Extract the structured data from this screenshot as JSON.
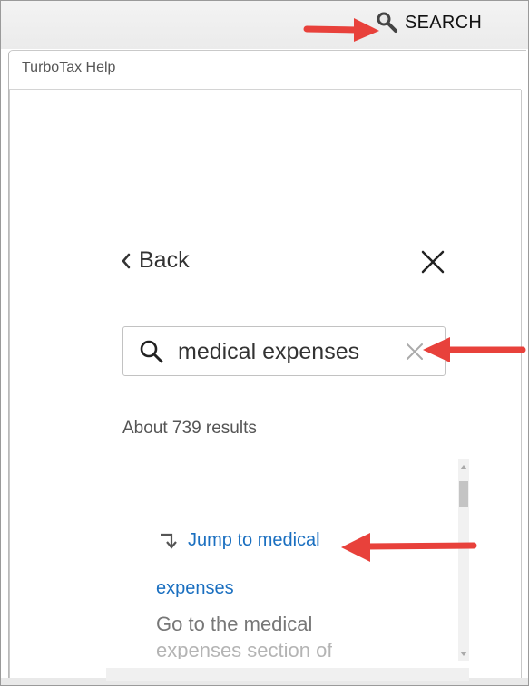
{
  "top_bar": {
    "search_label": "SEARCH",
    "search_icon": "magnifier-icon"
  },
  "panel": {
    "title": "TurboTax Help"
  },
  "nav": {
    "back_label": "Back",
    "back_icon": "chevron-left-icon",
    "close_icon": "close-icon"
  },
  "search": {
    "value": "medical expenses",
    "search_icon": "search-icon",
    "clear_icon": "clear-icon"
  },
  "results": {
    "count_text": "About 739 results",
    "first": {
      "jump_icon": "jump-arrow-icon",
      "link_line1": "Jump to medical",
      "link_line2": "expenses",
      "desc_line1": "Go to the medical",
      "desc_line2": "expenses section of"
    }
  },
  "annotation_arrows": {
    "color": "#e8413b"
  },
  "colors": {
    "link": "#1a6fc0",
    "arrow": "#e8413b",
    "text": "#333333",
    "muted": "#777777"
  }
}
